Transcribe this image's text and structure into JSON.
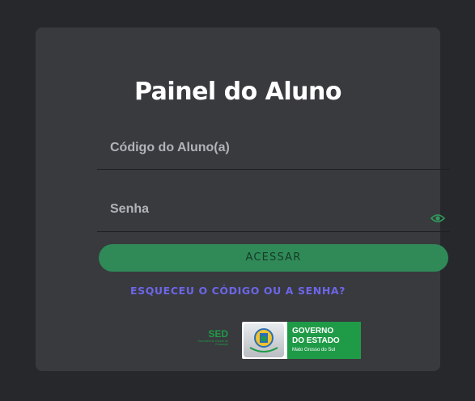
{
  "page": {
    "title": "Painel do Aluno"
  },
  "form": {
    "codigo_placeholder": "Código do Aluno(a)",
    "senha_placeholder": "Senha",
    "submit_label": "ACESSAR",
    "forgot_link": "ESQUECEU O CÓDIGO OU A SENHA?"
  },
  "icons": {
    "password_toggle": "eye-icon"
  },
  "logos": {
    "sed": {
      "name": "SED",
      "subtitle": "Secretaria de Estado de Educação"
    },
    "governo": {
      "line1": "GOVERNO",
      "line2": "DO ESTADO",
      "line3": "Mato Grosso do Sul"
    }
  },
  "colors": {
    "background": "#27282c",
    "card": "#393a3e",
    "button": "#2f8a58",
    "link": "#6d66e8",
    "brand_green": "#1f9a47"
  }
}
